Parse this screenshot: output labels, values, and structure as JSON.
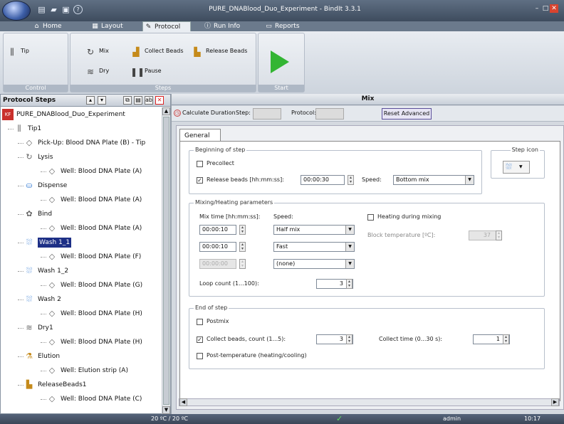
{
  "window": {
    "title": "PURE_DNABlood_Duo_Experiment - BindIt 3.3.1",
    "minimize": "–",
    "maximize": "□",
    "close": "✕"
  },
  "ribbon_tabs": [
    {
      "label": "Home"
    },
    {
      "label": "Layout"
    },
    {
      "label": "Protocol"
    },
    {
      "label": "Run Info"
    },
    {
      "label": "Reports"
    }
  ],
  "ribbon_groups": {
    "control": {
      "label": "Control",
      "tip": "Tip"
    },
    "steps": {
      "label": "Steps",
      "mix": "Mix",
      "collect_beads": "Collect Beads",
      "release_beads": "Release Beads",
      "dry": "Dry",
      "pause": "Pause"
    },
    "start": {
      "label": "Start"
    }
  },
  "protocol_steps": {
    "title": "Protocol Steps",
    "tree": [
      {
        "label": "PURE_DNABlood_Duo_Experiment",
        "icon": "kf-duo-icon",
        "level": 0
      },
      {
        "label": "Tip1",
        "icon": "tip-comb-icon",
        "level": 1
      },
      {
        "label": "Pick-Up: Blood DNA Plate (B) - Tip",
        "icon": "plate-icon",
        "level": 2
      },
      {
        "label": "Lysis",
        "icon": "lysis-icon",
        "level": 2
      },
      {
        "label": "Well: Blood DNA Plate (A)",
        "icon": "plate-icon",
        "level": 3
      },
      {
        "label": "Dispense",
        "icon": "dispense-icon",
        "level": 2
      },
      {
        "label": "Well: Blood DNA Plate (A)",
        "icon": "plate-icon",
        "level": 3
      },
      {
        "label": "Bind",
        "icon": "bind-icon",
        "level": 2
      },
      {
        "label": "Well: Blood DNA Plate (A)",
        "icon": "plate-icon",
        "level": 3
      },
      {
        "label": "Wash 1_1",
        "icon": "wash-icon",
        "level": 2,
        "selected": true
      },
      {
        "label": "Well: Blood DNA Plate (F)",
        "icon": "plate-icon",
        "level": 3
      },
      {
        "label": "Wash 1_2",
        "icon": "wash-icon",
        "level": 2
      },
      {
        "label": "Well: Blood DNA Plate (G)",
        "icon": "plate-icon",
        "level": 3
      },
      {
        "label": "Wash 2",
        "icon": "wash-icon",
        "level": 2
      },
      {
        "label": "Well: Blood DNA Plate (H)",
        "icon": "plate-icon",
        "level": 3
      },
      {
        "label": "Dry1",
        "icon": "dry-icon",
        "level": 2
      },
      {
        "label": "Well: Blood DNA Plate (H)",
        "icon": "plate-icon",
        "level": 3
      },
      {
        "label": "Elution",
        "icon": "elution-icon",
        "level": 2
      },
      {
        "label": "Well: Elution strip (A)",
        "icon": "plate-icon",
        "level": 3
      },
      {
        "label": "ReleaseBeads1",
        "icon": "release-beads-icon",
        "level": 2
      },
      {
        "label": "Well: Blood DNA Plate (C)",
        "icon": "plate-icon",
        "level": 3
      }
    ]
  },
  "editor": {
    "title": "Mix",
    "toolbar": {
      "calculate_duration": "Calculate Duration",
      "step_label": "Step:",
      "protocol_label": "Protocol:",
      "reset_advanced": "Reset Advanced"
    },
    "tab": "General",
    "beginning": {
      "legend": "Beginning of step",
      "precollect": "Precollect",
      "precollect_checked": false,
      "release_beads": "Release beads [hh:mm:ss]:",
      "release_beads_checked": true,
      "release_time": "00:00:30",
      "speed_label": "Speed:",
      "speed_value": "Bottom mix"
    },
    "step_icon": {
      "legend": "Step icon"
    },
    "mixing": {
      "legend": "Mixing/Heating parameters",
      "mix_time_label": "Mix time [hh:mm:ss]:",
      "speed_label": "Speed:",
      "rows": [
        {
          "time": "00:00:10",
          "speed": "Half mix",
          "disabled": false
        },
        {
          "time": "00:00:10",
          "speed": "Fast",
          "disabled": false
        },
        {
          "time": "00:00:00",
          "speed": "(none)",
          "disabled": true
        }
      ],
      "heating": "Heating during mixing",
      "heating_checked": false,
      "block_temp_label": "Block temperature [ºC]:",
      "block_temp_value": "37",
      "loop_count_label": "Loop count (1...100):",
      "loop_count_value": "3"
    },
    "end": {
      "legend": "End of step",
      "postmix": "Postmix",
      "postmix_checked": false,
      "collect_beads": "Collect beads, count (1...5):",
      "collect_beads_checked": true,
      "collect_count": "3",
      "collect_time_label": "Collect time (0...30 s):",
      "collect_time_value": "1",
      "post_temp": "Post-temperature (heating/cooling)",
      "post_temp_checked": false
    }
  },
  "status": {
    "temperature": "20 ºC / 20 ºC",
    "check": "✓",
    "user": "admin",
    "time": "10:17"
  },
  "colors": {
    "accent": "#1d2f86",
    "start_green": "#33b533",
    "close_red": "#d9442f"
  }
}
